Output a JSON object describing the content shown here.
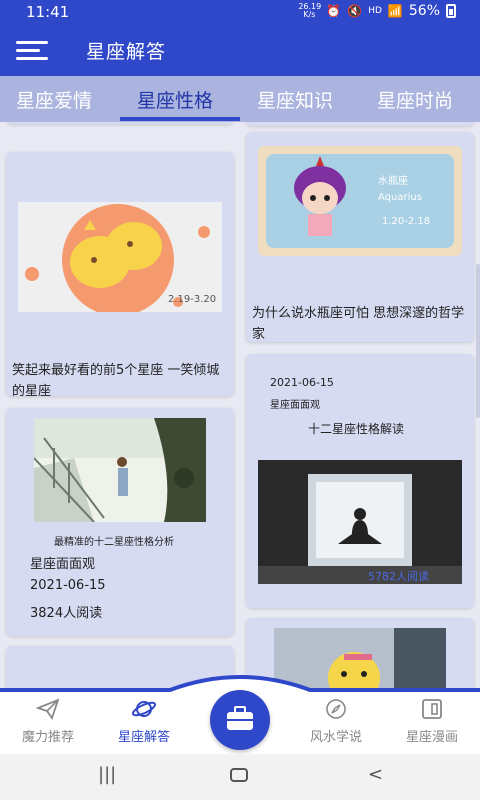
{
  "status": {
    "time": "11:41",
    "net_speed_value": "26.19",
    "net_speed_unit": "K/s",
    "network": "HD",
    "battery": "56%"
  },
  "app_bar": {
    "title": "星座解答"
  },
  "tabs": [
    {
      "label": "星座爱情",
      "active": false
    },
    {
      "label": "星座性格",
      "active": true
    },
    {
      "label": "星座知识",
      "active": false
    },
    {
      "label": "星座时尚",
      "active": false
    }
  ],
  "cards": {
    "left1": {
      "title": "笑起来最好看的前5个星座 一笑倾城的星座"
    },
    "left2": {
      "caption": "最精准的十二星座性格分析",
      "source": "星座面面观",
      "date": "2021-06-15",
      "reads": "3824人阅读"
    },
    "right1": {
      "title": "为什么说水瓶座可怕 思想深邃的哲学家",
      "thumb_sign": "水瓶座",
      "thumb_sign_en": "Aquarius",
      "thumb_dates": "1.20-2.18"
    },
    "right2": {
      "date": "2021-06-15",
      "source": "星座面面观",
      "title": "十二星座性格解读",
      "reads_overlay": "5782人阅读"
    },
    "left1_thumb_dates": "2.19-3.20"
  },
  "bottom_nav": [
    {
      "label": "魔力推荐",
      "icon": "paper-plane-icon"
    },
    {
      "label": "星座解答",
      "icon": "planet-icon"
    },
    {
      "label": "风水学说",
      "icon": "compass-icon"
    },
    {
      "label": "星座漫画",
      "icon": "comic-icon"
    }
  ],
  "center_icon": "briefcase-icon",
  "colors": {
    "primary": "#2f47c9",
    "tab_bg": "#aab4de",
    "card_bg": "#d6dbf2"
  }
}
